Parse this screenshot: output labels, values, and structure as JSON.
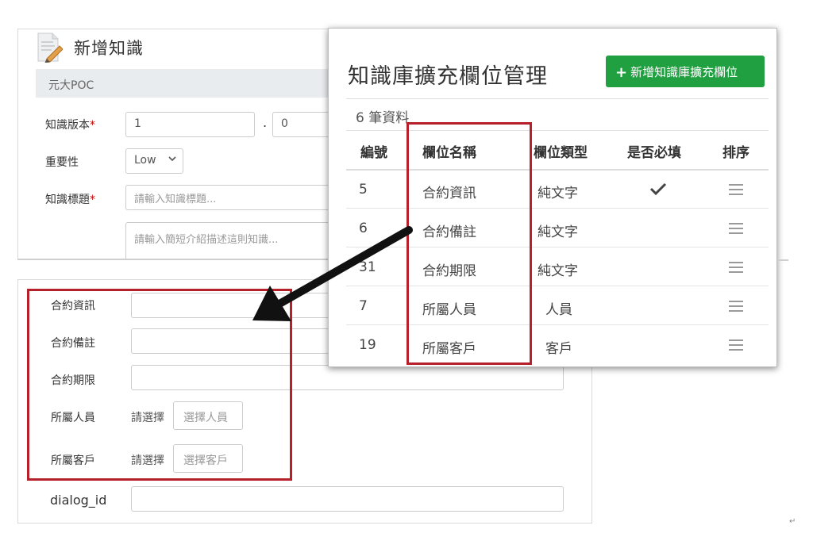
{
  "form": {
    "title": "新增知識",
    "org": "元大POC",
    "version_label": "知識版本",
    "required_mark": "*",
    "version_major": "1",
    "version_sep": ".",
    "version_minor": "0",
    "importance_label": "重要性",
    "importance_value": "Low",
    "title_label": "知識標題",
    "title_placeholder": "請輸入知識標題...",
    "summary_placeholder": "請輸入簡短介紹描述這則知識..."
  },
  "custom_fields": {
    "contract_info": "合約資訊",
    "contract_note": "合約備註",
    "contract_term": "合約期限",
    "staff_label": "所屬人員",
    "staff_hint": "請選擇",
    "staff_button": "選擇人員",
    "customer_label": "所屬客戶",
    "customer_hint": "請選擇",
    "customer_button": "選擇客戶",
    "dialog_id_label": "dialog_id"
  },
  "panel": {
    "title": "知識庫擴充欄位管理",
    "add_button": "新增知識庫擴充欄位",
    "count": "6 筆資料",
    "headers": [
      "編號",
      "欄位名稱",
      "欄位類型",
      "是否必填",
      "排序"
    ],
    "rows": [
      {
        "id": "5",
        "name": "合約資訊",
        "type": "純文字",
        "required": true
      },
      {
        "id": "6",
        "name": "合約備註",
        "type": "純文字",
        "required": false
      },
      {
        "id": "31",
        "name": "合約期限",
        "type": "純文字",
        "required": false
      },
      {
        "id": "7",
        "name": "所屬人員",
        "type": "人員",
        "required": false
      },
      {
        "id": "19",
        "name": "所屬客戶",
        "type": "客戶",
        "required": false
      }
    ]
  },
  "colors": {
    "accent_green": "#21a042",
    "highlight_red": "#b5202a"
  },
  "icons": {
    "form_icon": "document-edit-icon",
    "check": "check-icon",
    "sort": "drag-handle-icon",
    "plus": "plus-icon",
    "arrow": "arrow-icon"
  }
}
